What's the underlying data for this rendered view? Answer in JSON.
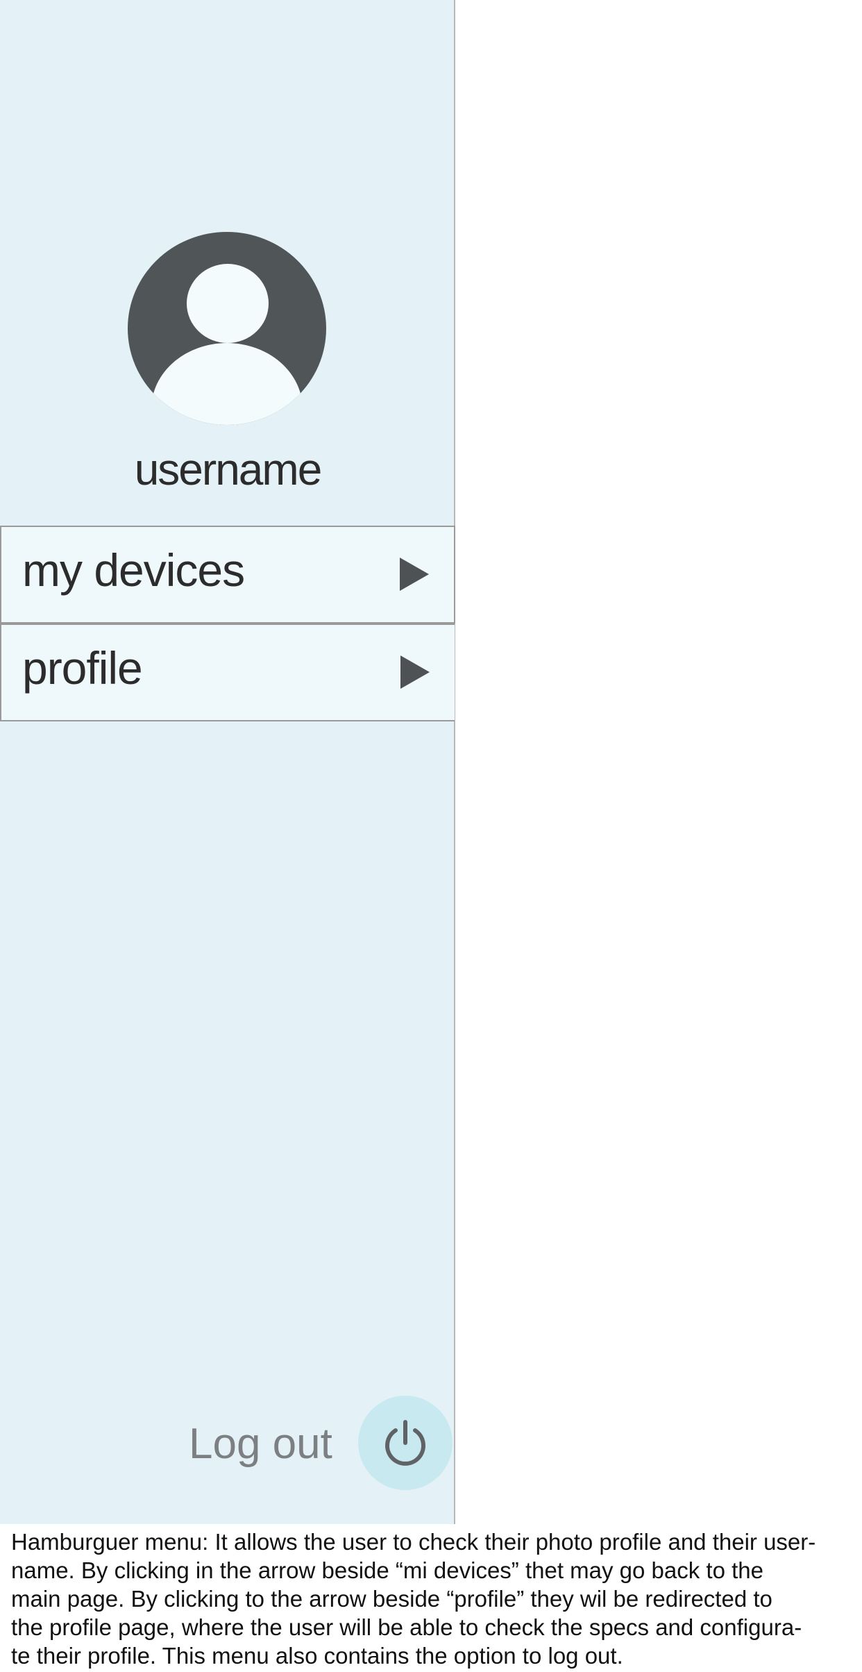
{
  "drawer": {
    "username": "username",
    "menu": [
      {
        "label": "my devices",
        "icon": "play-arrow-icon"
      },
      {
        "label": "profile",
        "icon": "play-arrow-icon"
      }
    ],
    "logout": {
      "label": "Log out",
      "icon": "power-icon"
    }
  },
  "caption": {
    "lines": [
      "Hamburguer menu: It allows the user to check their photo profile and their user-",
      "name. By clicking in the arrow beside “mi devices” thet may go back to the",
      "main page. By clicking to the arrow beside “profile” they wil be redirected to",
      "the profile page, where the user will be able to check the specs and configura-",
      "te their profile. This menu also contains the option to log out."
    ]
  },
  "colors": {
    "drawer_bg": "#e4f2f8",
    "menu_item_bg": "#eff8fb",
    "avatar": "#505558",
    "power_button_bg": "#c9e9f0",
    "logout_text": "#7d8082"
  }
}
